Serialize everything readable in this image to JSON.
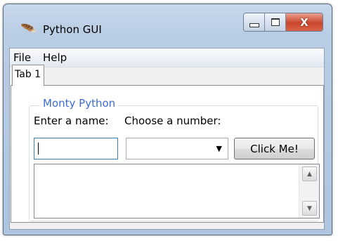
{
  "window": {
    "title": "Python GUI",
    "icon": "feather-icon",
    "caption_buttons": {
      "minimize": "minimize-icon",
      "maximize": "maximize-icon",
      "close": "close-icon",
      "close_glyph": "X"
    }
  },
  "menubar": {
    "items": [
      {
        "label": "File"
      },
      {
        "label": "Help"
      }
    ]
  },
  "tabs": [
    {
      "label": "Tab 1",
      "selected": true
    }
  ],
  "frame": {
    "label": "Monty Python",
    "label_color": "#3c6bd7"
  },
  "form": {
    "name_label": "Enter a name:",
    "name_value": "",
    "number_label": "Choose a number:",
    "number_value": "",
    "button_label": "Click Me!"
  },
  "text_area": {
    "value": ""
  },
  "colors": {
    "frame_label": "#3c6bd7",
    "entry_focus_border": "#3c7fb1",
    "close_button": "#c9452b"
  }
}
